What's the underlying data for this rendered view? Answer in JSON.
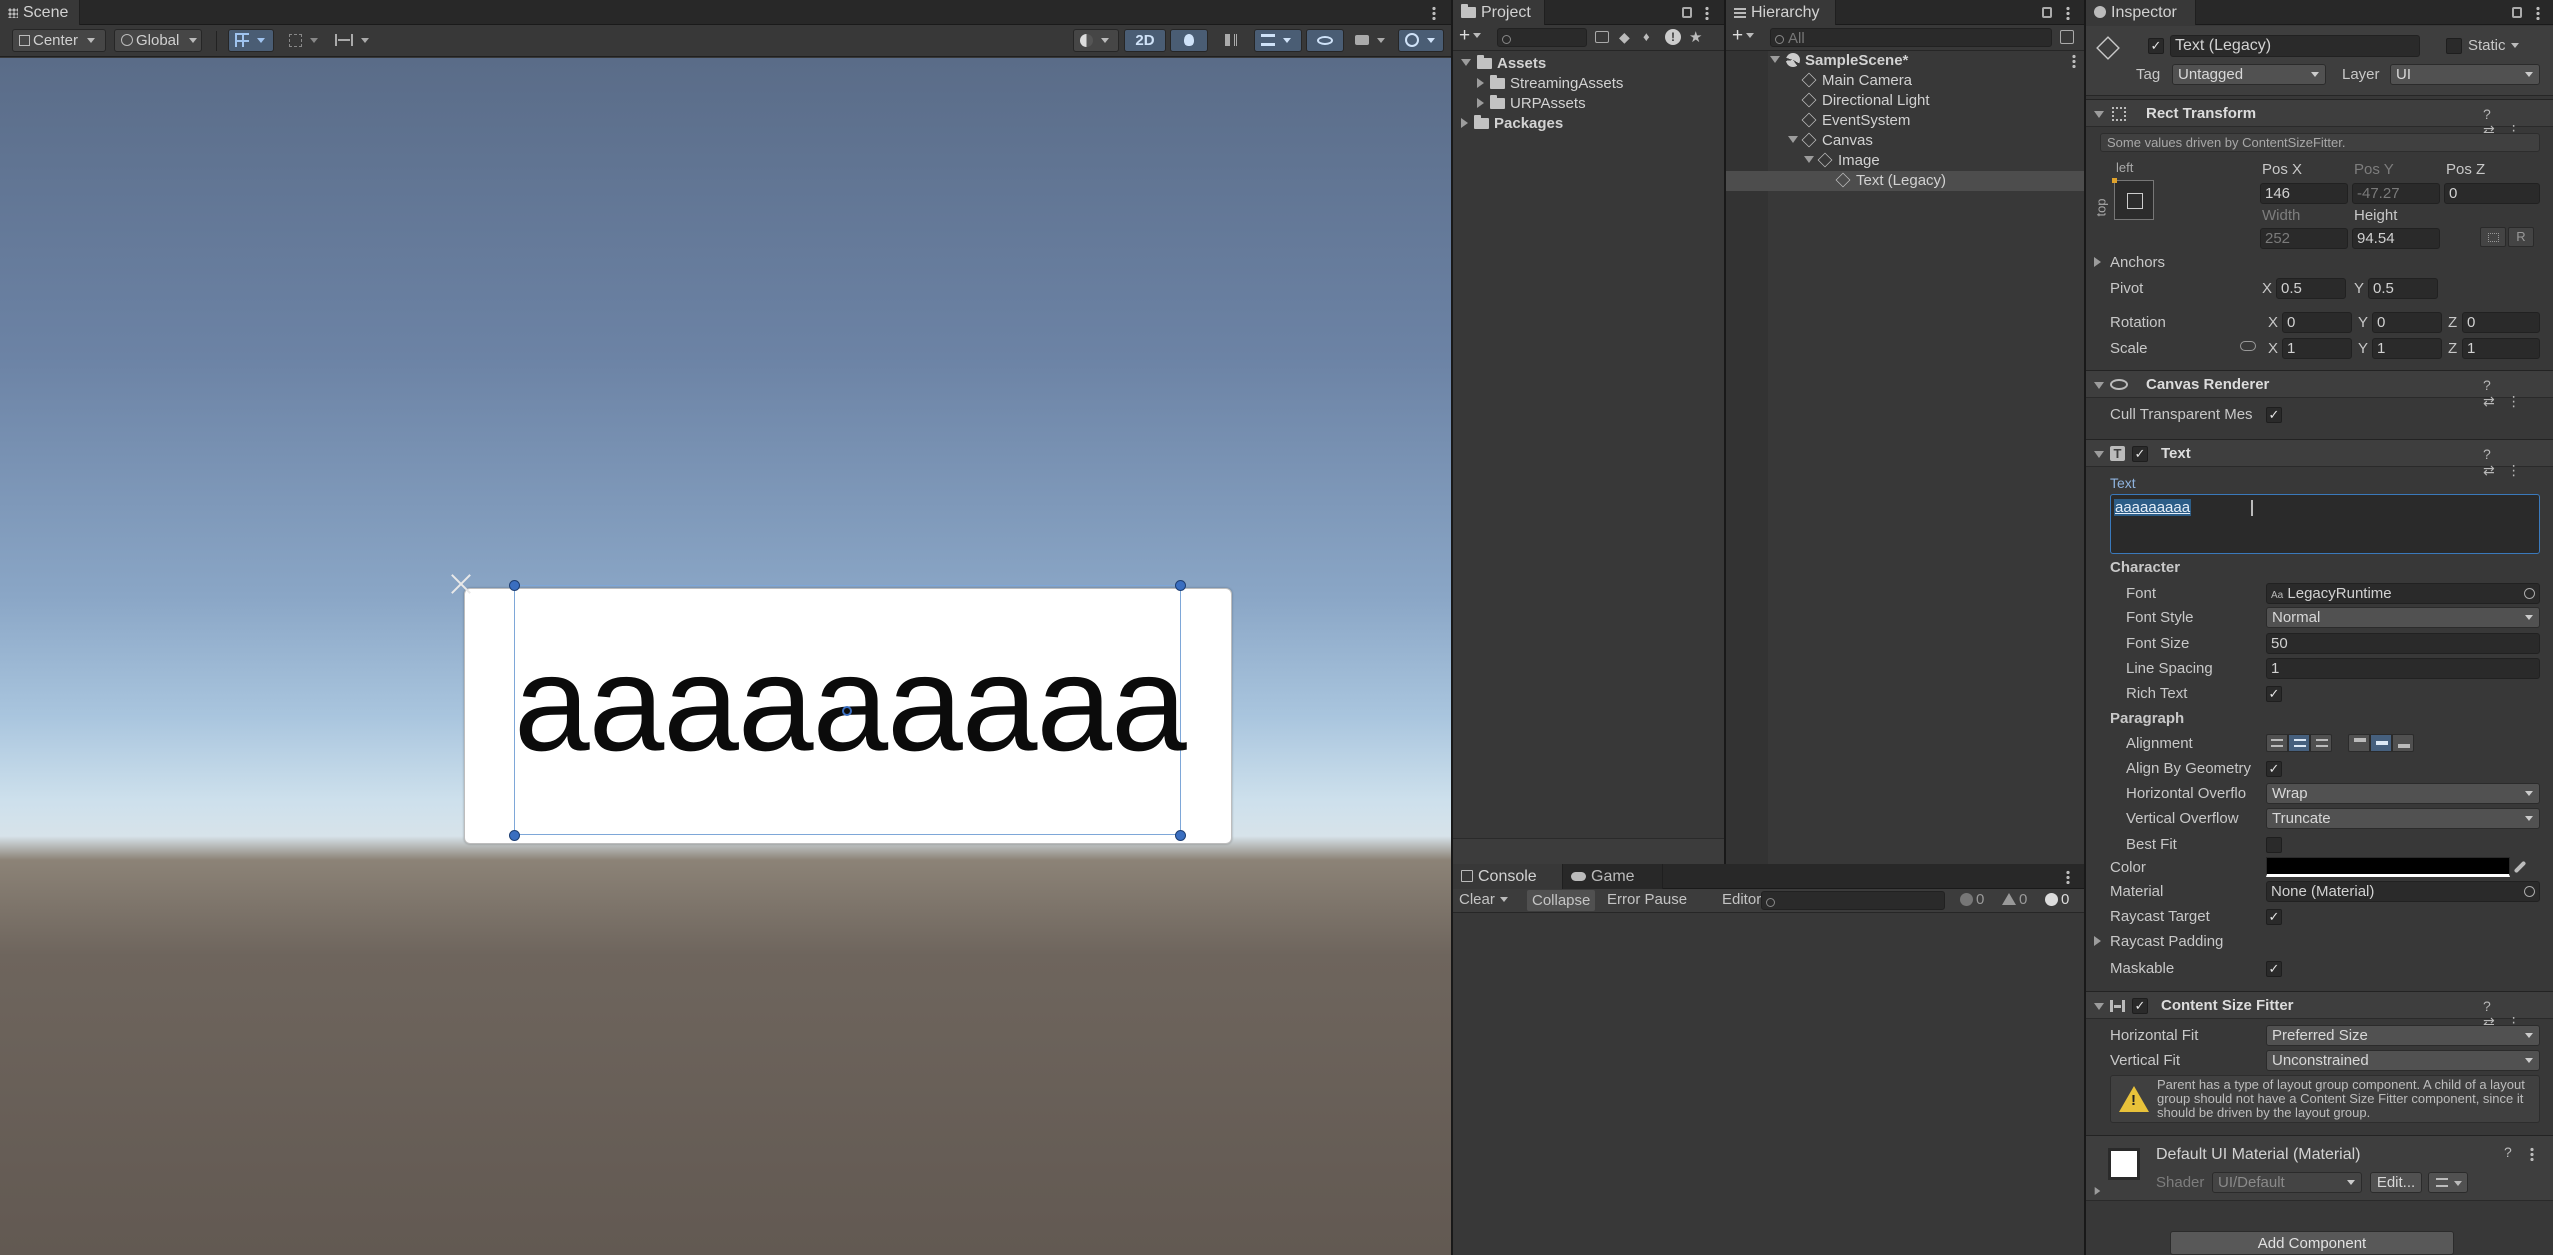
{
  "scene": {
    "tab_label": "Scene",
    "pivot_mode": "Center",
    "space_mode": "Global",
    "mode_2d": "2D",
    "canvas_text": "aaaaaaaaa"
  },
  "project": {
    "tab_label": "Project",
    "tree": [
      "Assets",
      "StreamingAssets",
      "URPAssets",
      "Packages"
    ]
  },
  "hierarchy": {
    "tab_label": "Hierarchy",
    "search_placeholder": "All",
    "items": [
      "SampleScene*",
      "Main Camera",
      "Directional Light",
      "EventSystem",
      "Canvas",
      "Image",
      "Text (Legacy)"
    ]
  },
  "console": {
    "tabs": [
      "Console",
      "Game"
    ],
    "clear": "Clear",
    "collapse": "Collapse",
    "error_pause": "Error Pause",
    "editor": "Editor",
    "counts": [
      "0",
      "0",
      "0"
    ]
  },
  "inspector": {
    "tab_label": "Inspector",
    "object_name": "Text (Legacy)",
    "static_label": "Static",
    "tag_label": "Tag",
    "tag_value": "Untagged",
    "layer_label": "Layer",
    "layer_value": "UI",
    "rect_transform": {
      "title": "Rect Transform",
      "note": "Some values driven by ContentSizeFitter.",
      "anchor_h": "left",
      "anchor_v": "top",
      "posx_label": "Pos X",
      "posy_label": "Pos Y",
      "posz_label": "Pos Z",
      "posx": "146",
      "posy": "-47.27",
      "posz": "0",
      "width_label": "Width",
      "height_label": "Height",
      "width": "252",
      "height": "94.54",
      "raw_btn": "R",
      "anchors_label": "Anchors",
      "pivot_label": "Pivot",
      "pivot_x": "0.5",
      "pivot_y": "0.5",
      "rotation_label": "Rotation",
      "rot_x": "0",
      "rot_y": "0",
      "rot_z": "0",
      "scale_label": "Scale",
      "scale_x": "1",
      "scale_y": "1",
      "scale_z": "1",
      "x": "X",
      "y": "Y",
      "z": "Z"
    },
    "canvas_renderer": {
      "title": "Canvas Renderer",
      "cull_label": "Cull Transparent Mes"
    },
    "text": {
      "title": "Text",
      "text_label": "Text",
      "text_value": "aaaaaaaaa",
      "character_header": "Character",
      "font_label": "Font",
      "font_value": "LegacyRuntime",
      "font_prefix": "Aa",
      "font_style_label": "Font Style",
      "font_style_value": "Normal",
      "font_size_label": "Font Size",
      "font_size_value": "50",
      "line_spacing_label": "Line Spacing",
      "line_spacing_value": "1",
      "rich_text_label": "Rich Text",
      "paragraph_header": "Paragraph",
      "alignment_label": "Alignment",
      "align_by_geometry_label": "Align By Geometry",
      "h_overflow_label": "Horizontal Overflo",
      "h_overflow_value": "Wrap",
      "v_overflow_label": "Vertical Overflow",
      "v_overflow_value": "Truncate",
      "best_fit_label": "Best Fit",
      "color_label": "Color",
      "color_value": "#000000",
      "material_label": "Material",
      "material_value": "None (Material)",
      "raycast_target_label": "Raycast Target",
      "raycast_padding_label": "Raycast Padding",
      "maskable_label": "Maskable"
    },
    "content_size_fitter": {
      "title": "Content Size Fitter",
      "h_fit_label": "Horizontal Fit",
      "h_fit_value": "Preferred Size",
      "v_fit_label": "Vertical Fit",
      "v_fit_value": "Unconstrained",
      "warning": "Parent has a type of layout group component. A child of a layout group should not have a Content Size Fitter component, since it should be driven by the layout group."
    },
    "material": {
      "name": "Default UI Material (Material)",
      "shader_label": "Shader",
      "shader_value": "UI/Default",
      "edit_btn": "Edit..."
    },
    "add_component": "Add Component"
  },
  "colors": {
    "accent": "#3a79bb",
    "selection": "#2c5d87",
    "panel": "#383838",
    "warning": "#e8c23a"
  }
}
